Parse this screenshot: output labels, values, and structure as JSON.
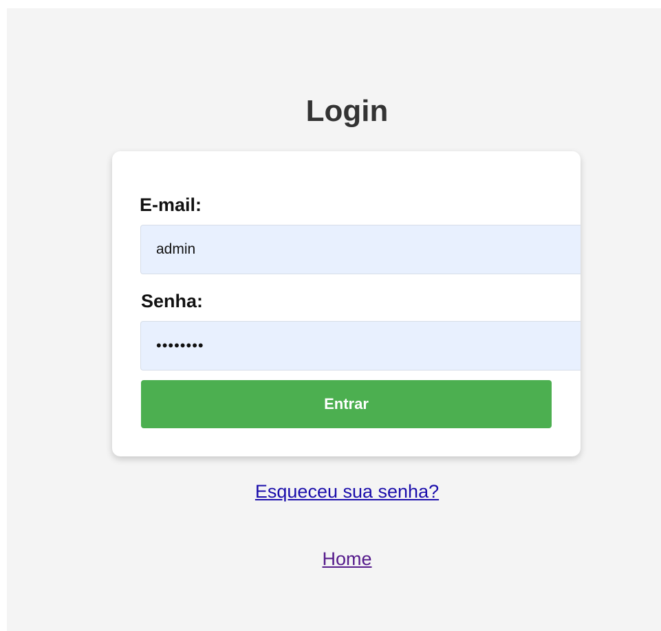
{
  "login": {
    "title": "Login",
    "email_label": "E-mail:",
    "email_value": "admin",
    "password_label": "Senha:",
    "password_value": "••••••••",
    "submit_label": "Entrar",
    "forgot_link": "Esqueceu sua senha?",
    "home_link": "Home"
  },
  "colors": {
    "background": "#f4f4f4",
    "card": "#ffffff",
    "input_background": "#e8f0fe",
    "button": "#4caf50",
    "link": "#1a0dab",
    "visited_link": "#551a8b"
  }
}
